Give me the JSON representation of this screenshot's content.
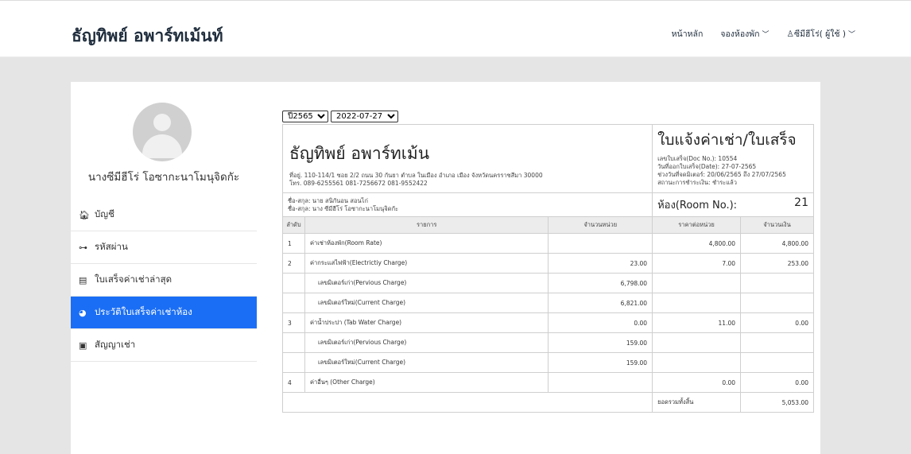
{
  "nav": {
    "brand": "ธัญทิพย์ อพาร์ทเม้นท์",
    "home": "หน้าหลัก",
    "booking": "จองห้องพัก",
    "user": "ซีมีฮีโร่( ผู้ใช้ )"
  },
  "profile": {
    "name": "นางซีมีฮีโร่ โอซากะนาโมนุจิดกัะ"
  },
  "menu": [
    {
      "label": "บัญชี",
      "icon": "home-icon"
    },
    {
      "label": "รหัสผ่าน",
      "icon": "key-icon"
    },
    {
      "label": "ใบเสร็จค่าเช่าล่าสุด",
      "icon": "receipt-icon"
    },
    {
      "label": "ประวัติใบเสร็จค่าเช่าห้อง",
      "icon": "history-icon"
    },
    {
      "label": "สัญญาเช่า",
      "icon": "contract-icon"
    }
  ],
  "filters": {
    "year": "ปี2565",
    "date": "2022-07-27"
  },
  "invoice": {
    "company": "ธัญทิพย์ อพาร์ทเม้น",
    "address": "ที่อยู่. 110-114/1 ซอย 2/2 ถนน 30 กันยา ตำบล ในเมือง อำเภอ เมือง จังหวัดนครราชสีมา 30000",
    "phone": "โทร. 089-6255561 081-7256672 081-9552422",
    "title": "ใบแจ้งค่าเช่า/ใบเสร็จ",
    "doc_no": "เลขใบเสร็จ(Doc No.): 10554",
    "doc_date": "วันที่ออกใบเสร็จ(Date): 27-07-2565",
    "meter_period": "ช่วงวันที่จดมิเตอร์: 20/06/2565 ถึง 27/07/2565",
    "status": "สถานะการชำระเงิน: ชำระแล้ว",
    "tenant1": "ชื่อ-สกุล: นาย สนิกันอน สอนไก่",
    "tenant2": "ชื่อ-สกุล: นาง ซีมีฮีโร่ โอซากะนาโมนุจิดกัะ",
    "room_label": "ห้อง(Room No.):",
    "room_no": "21",
    "columns": [
      "ลำดับ",
      "รายการ",
      "จำนวนหน่วย",
      "ราคาต่อหน่วย",
      "จำนวนเงิน"
    ],
    "rows": [
      {
        "no": "1",
        "item": "ค่าเช่าห้องพัก(Room Rate)",
        "units": "",
        "price": "4,800.00",
        "amount": "4,800.00"
      },
      {
        "no": "2",
        "item": "ค่ากระแสไฟฟ้า(Electrictiy Charge)",
        "units": "23.00",
        "price": "7.00",
        "amount": "253.00"
      },
      {
        "no": "",
        "item": "เลขมิเตอร์เก่า(Pervious Charge)",
        "units": "6,798.00",
        "price": "",
        "amount": "",
        "sub": true
      },
      {
        "no": "",
        "item": "เลขมิเตอร์ใหม่(Current Charge)",
        "units": "6,821.00",
        "price": "",
        "amount": "",
        "sub": true
      },
      {
        "no": "3",
        "item": "ค่าน้ำประปา (Tab Water Charge)",
        "units": "0.00",
        "price": "11.00",
        "amount": "0.00"
      },
      {
        "no": "",
        "item": "เลขมิเตอร์เก่า(Pervious Charge)",
        "units": "159.00",
        "price": "",
        "amount": "",
        "sub": true
      },
      {
        "no": "",
        "item": "เลขมิเตอร์ใหม่(Current Charge)",
        "units": "159.00",
        "price": "",
        "amount": "",
        "sub": true
      },
      {
        "no": "4",
        "item": "ค่าอื่นๆ (Other Charge)",
        "units": "",
        "price": "0.00",
        "amount": "0.00"
      }
    ],
    "total_label": "ยอดรวมทั้งสิ้น",
    "total": "5,053.00"
  }
}
